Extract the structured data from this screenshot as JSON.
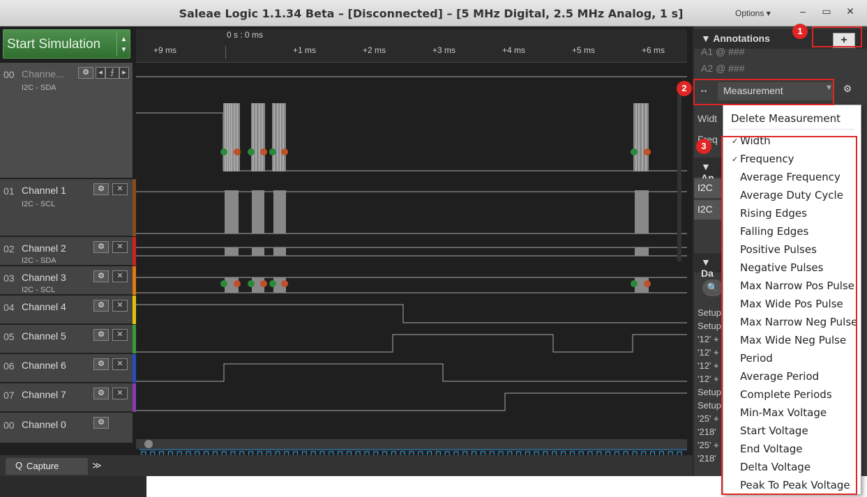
{
  "window": {
    "title": "Saleae Logic 1.1.34 Beta – [Disconnected] – [5 MHz Digital, 2.5 MHz Analog, 1 s]",
    "options_label": "Options ▾",
    "minimize": "–",
    "maximize": "▭",
    "close": "✕"
  },
  "toolbar": {
    "start_label": "Start Simulation",
    "up_arrow": "▲",
    "down_arrow": "▼"
  },
  "timeline": {
    "center_label": "0 s : 0 ms",
    "ticks": [
      "+9 ms",
      "+1 ms",
      "+2 ms",
      "+3 ms",
      "+4 ms",
      "+5 ms",
      "+6 ms"
    ]
  },
  "channels": [
    {
      "num": "00",
      "name": "Channe...",
      "sub": "I2C - SDA",
      "color": "#444444"
    },
    {
      "num": "01",
      "name": "Channel 1",
      "sub": "I2C - SCL",
      "color": "#8a4a1a"
    },
    {
      "num": "02",
      "name": "Channel 2",
      "sub": "I2C - SDA",
      "color": "#cc2222"
    },
    {
      "num": "03",
      "name": "Channel 3",
      "sub": "I2C - SCL",
      "color": "#e07a10"
    },
    {
      "num": "04",
      "name": "Channel 4",
      "sub": "",
      "color": "#e0c010"
    },
    {
      "num": "05",
      "name": "Channel 5",
      "sub": "",
      "color": "#3a9a3a"
    },
    {
      "num": "06",
      "name": "Channel 6",
      "sub": "",
      "color": "#2a4ac0"
    },
    {
      "num": "07",
      "name": "Channel 7",
      "sub": "",
      "color": "#8a3ab0"
    },
    {
      "num": "00",
      "name": "Channel 0",
      "sub": "",
      "color": "#444444"
    }
  ],
  "channel_controls": {
    "gear": "⚙",
    "close": "✕",
    "prev": "◂",
    "edge": "⨍",
    "next": "▸"
  },
  "bottom": {
    "capture_label": "Capture",
    "capture_icon": "Q",
    "more": "≫"
  },
  "panel": {
    "annotations_title": "Annotations",
    "plus": "+",
    "a1": "A1  @  ###",
    "a2": "A2  @  ###",
    "measurement_label": "Measurement",
    "lr_icon": "↔",
    "gear": "⚙",
    "dropdown": "▼",
    "width_partial": "Widt",
    "freq_partial": "Freq",
    "analyzers_partial": "An",
    "i2c_rows": [
      "I2C",
      "I2C"
    ],
    "decoded_partial": "Da",
    "decoded_rows": [
      "Setup",
      "Setup",
      "'12' +",
      "'12' +",
      "'12' +",
      "'12' +",
      "Setup",
      "Setup",
      "'25' +",
      "'218'",
      "'25' +",
      "'218'"
    ],
    "search_icon": "🔍"
  },
  "menu": {
    "delete": "Delete Measurement",
    "items": [
      "Width",
      "Frequency",
      "Average Frequency",
      "Average Duty Cycle",
      "Rising Edges",
      "Falling Edges",
      "Positive Pulses",
      "Negative Pulses",
      "Max Narrow Pos Pulse",
      "Max Wide Pos Pulse",
      "Max Narrow Neg Pulse",
      "Max Wide Neg Pulse",
      "Period",
      "Average Period",
      "Complete Periods",
      "Min-Max Voltage",
      "Start Voltage",
      "End Voltage",
      "Delta Voltage",
      "Peak To Peak Voltage"
    ],
    "checkmark": "✓"
  },
  "callouts": [
    "1",
    "2",
    "3"
  ],
  "colors": {
    "accent": "#e02525",
    "start_green": "#3a7f3a",
    "dot_green": "#2a8a3a",
    "dot_red": "#c0502a",
    "analog_blue": "#3aa0e0"
  }
}
